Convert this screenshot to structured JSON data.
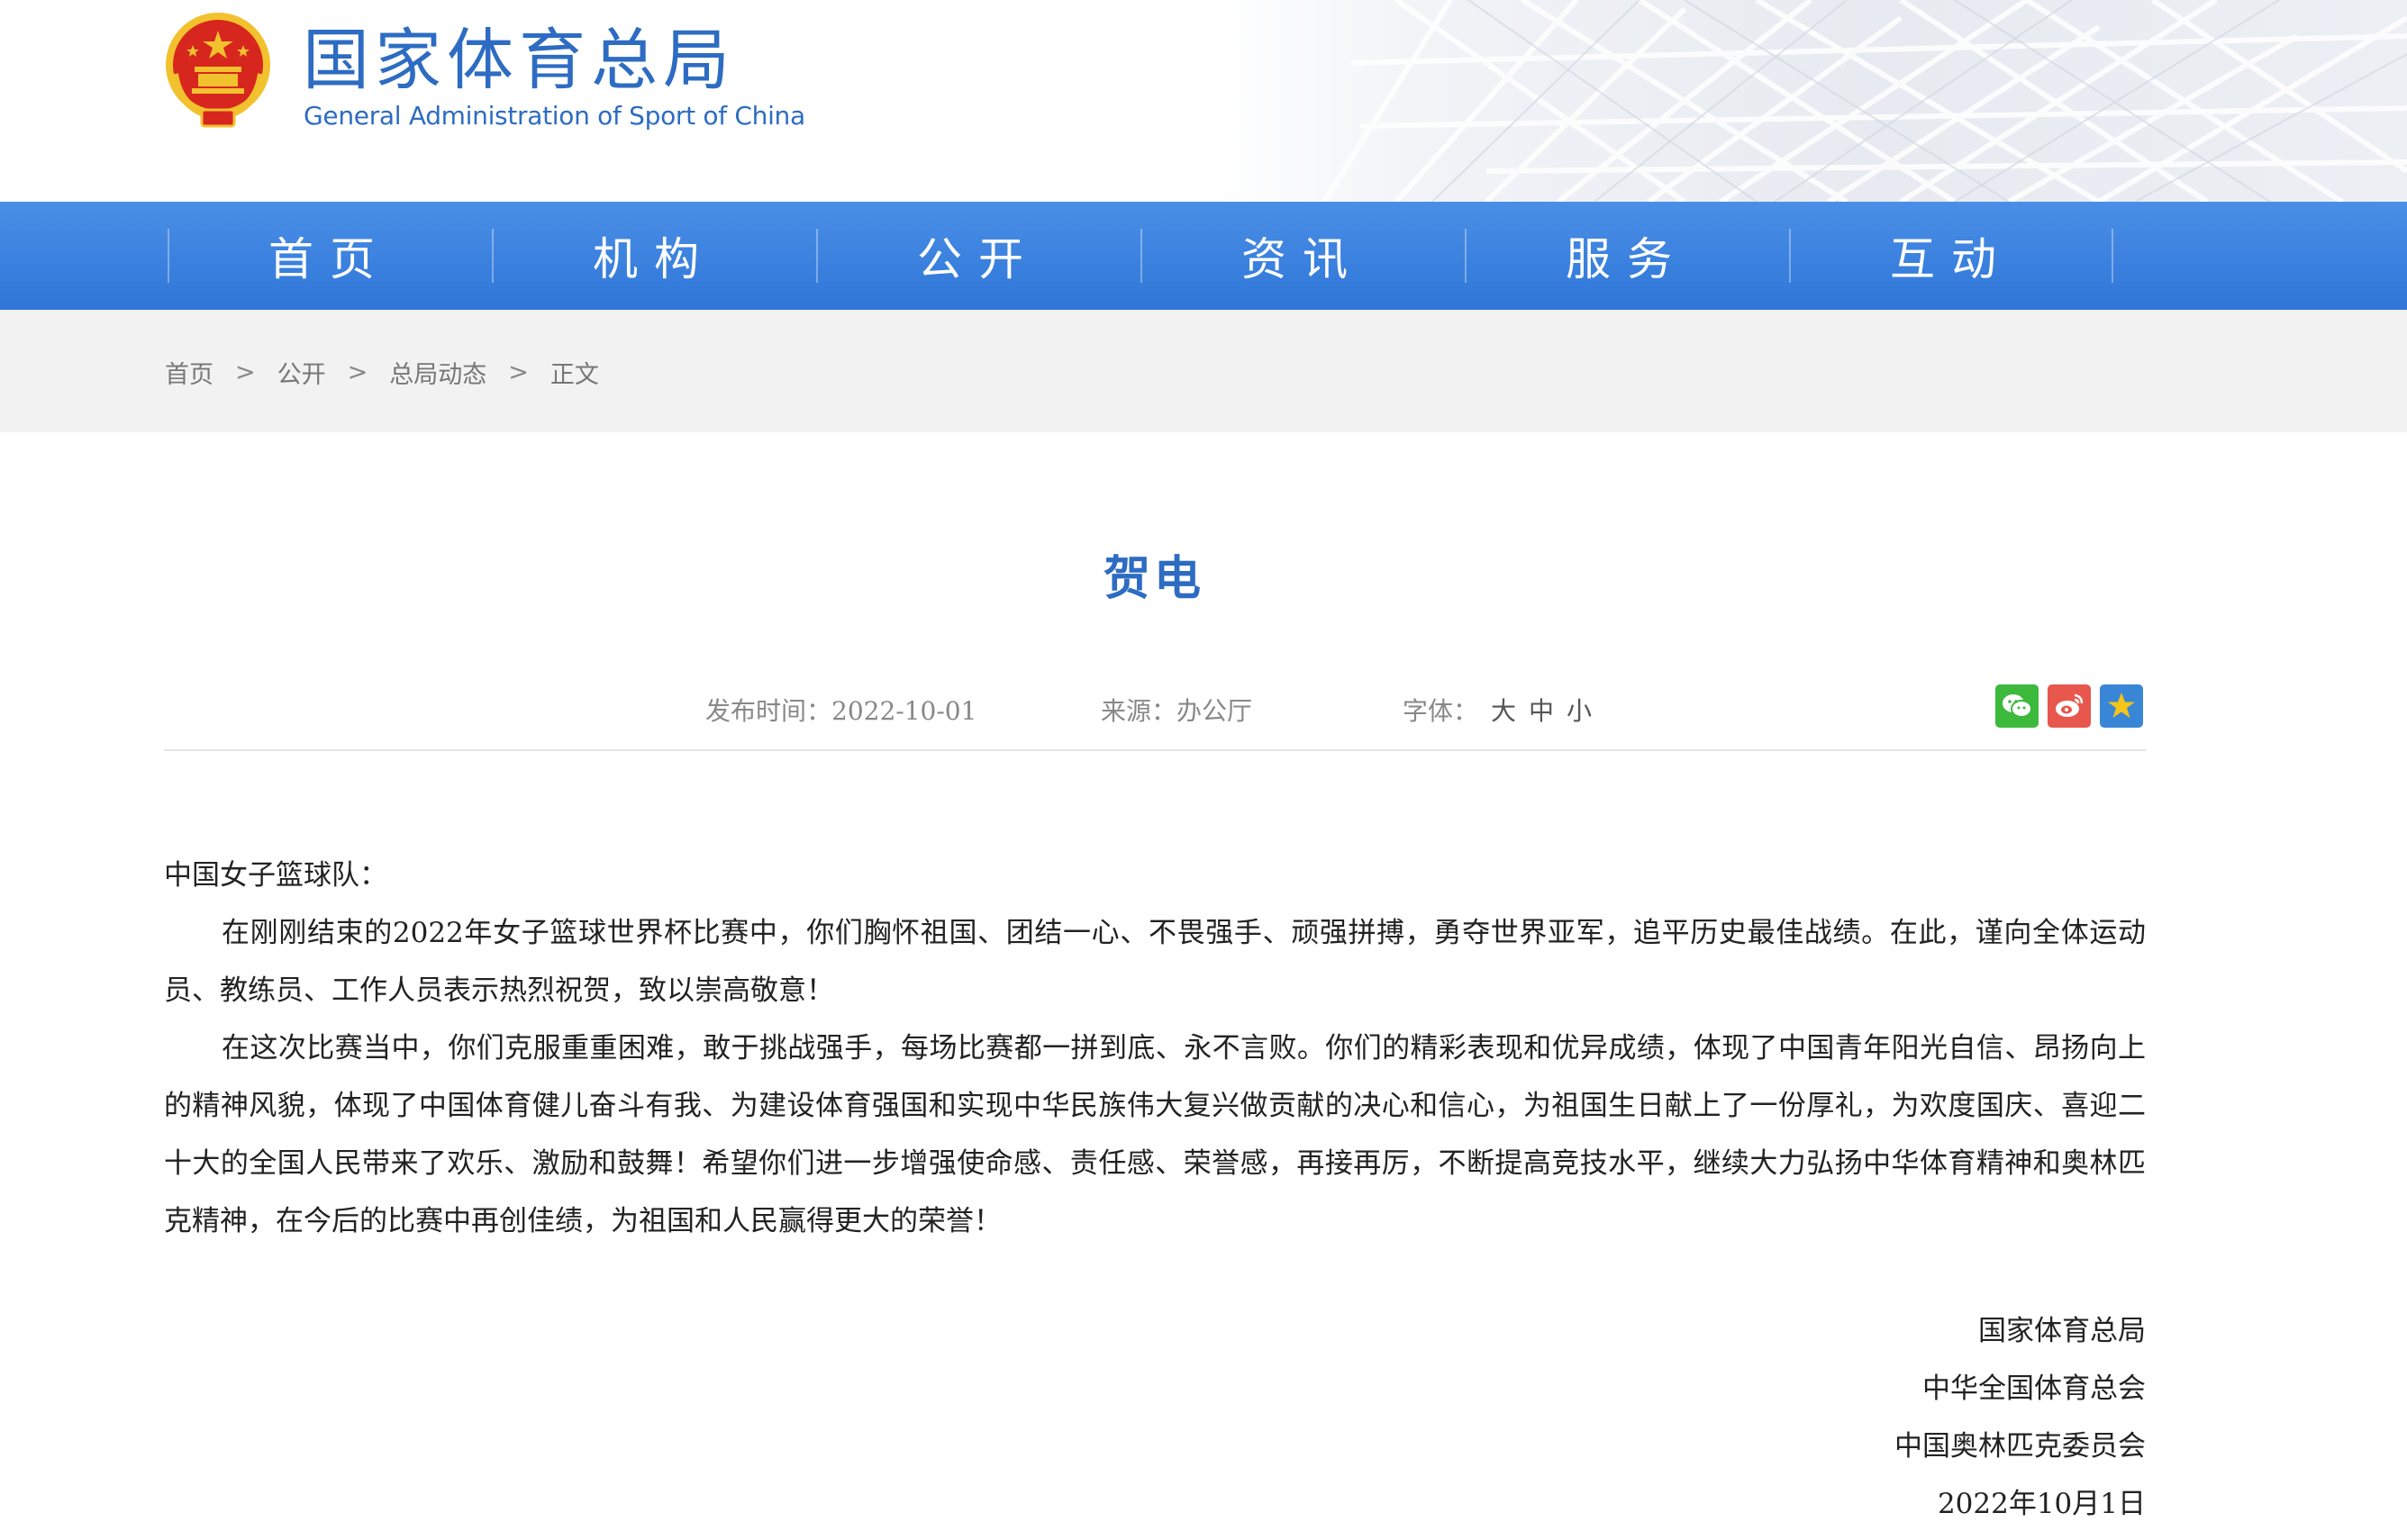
{
  "header": {
    "site_title": "国家体育总局",
    "site_title_en": "General Administration of Sport of China"
  },
  "nav": {
    "items": [
      {
        "label": "首页"
      },
      {
        "label": "机构"
      },
      {
        "label": "公开"
      },
      {
        "label": "资讯"
      },
      {
        "label": "服务"
      },
      {
        "label": "互动"
      }
    ]
  },
  "breadcrumb": {
    "items": [
      "首页",
      "公开",
      "总局动态",
      "正文"
    ],
    "separator": ">"
  },
  "article": {
    "title": "贺电",
    "published_label": "发布时间：2022-10-01",
    "source_label": "来源：办公厅",
    "font_label": "字体：",
    "font_sizes": [
      "大",
      "中",
      "小"
    ],
    "share_icons": [
      "wechat-icon",
      "weibo-icon",
      "favorite-star-icon"
    ],
    "salutation": "中国女子篮球队：",
    "paragraphs": [
      "在刚刚结束的2022年女子篮球世界杯比赛中，你们胸怀祖国、团结一心、不畏强手、顽强拼搏，勇夺世界亚军，追平历史最佳战绩。在此，谨向全体运动员、教练员、工作人员表示热烈祝贺，致以崇高敬意！",
      "在这次比赛当中，你们克服重重困难，敢于挑战强手，每场比赛都一拼到底、永不言败。你们的精彩表现和优异成绩，体现了中国青年阳光自信、昂扬向上的精神风貌，体现了中国体育健儿奋斗有我、为建设体育强国和实现中华民族伟大复兴做贡献的决心和信心，为祖国生日献上了一份厚礼，为欢度国庆、喜迎二十大的全国人民带来了欢乐、激励和鼓舞！希望你们进一步增强使命感、责任感、荣誉感，再接再厉，不断提高竞技水平，继续大力弘扬中华体育精神和奥林匹克精神，在今后的比赛中再创佳绩，为祖国和人民赢得更大的荣誉！"
    ],
    "signatures": [
      "国家体育总局",
      "中华全国体育总会",
      "中国奥林匹克委员会",
      "2022年10月1日"
    ]
  },
  "colors": {
    "brand_blue": "#2d6cc2",
    "nav_blue": "#3a80df",
    "emblem_red": "#d7261e",
    "emblem_gold": "#f2c12e"
  }
}
